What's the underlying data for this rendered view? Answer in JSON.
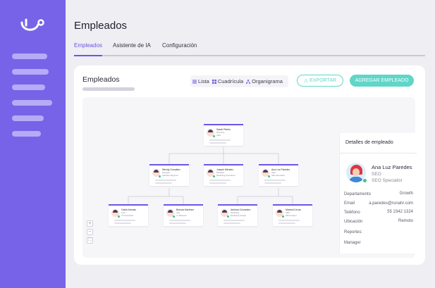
{
  "page": {
    "title": "Empleados",
    "tabs": [
      {
        "label": "Empleados",
        "active": true
      },
      {
        "label": "Asistente de IA",
        "active": false
      },
      {
        "label": "Configuración",
        "active": false
      }
    ]
  },
  "card": {
    "title": "Empleados",
    "views": {
      "list": "Lista",
      "grid": "Cuadrícula",
      "org": "Organigrama",
      "selected": "org"
    },
    "export_label": "EXPORTAR",
    "add_label": "AGREGAR EMPLEADO"
  },
  "org_chart": {
    "root": {
      "name": "Sarah Peters",
      "role": "Directora",
      "role2": "CEO"
    },
    "managers": [
      {
        "name": "Wendy González",
        "role": "Manager",
        "role2": "Software Engineer"
      },
      {
        "name": "Joseph Méndez",
        "role": "Manager",
        "role2": "Marketing Operations"
      },
      {
        "name": "Ana Luz Paredes",
        "role": "SEO",
        "role2": "SEO Specialist"
      }
    ],
    "reports": [
      {
        "name": "Caleb Arévalo",
        "role": "Tech",
        "role2": "IT Procesador"
      },
      {
        "name": "Brenda Martínez",
        "role": "Arte",
        "role2": "Jr. Backend"
      },
      {
        "name": "Adriana Cervantes",
        "role": "Marketing",
        "role2": "Marketing Analyst"
      },
      {
        "name": "Marbrel Urzúa",
        "role": "SEO",
        "role2": "SEO Analyst"
      }
    ],
    "zoom": [
      "+",
      "−",
      "⛶"
    ]
  },
  "detail": {
    "header": "Detalles de empleado",
    "name": "Ana Luz Paredes",
    "role": "SEO",
    "role2": "SEO Specialist",
    "fields": [
      {
        "label": "Departamento",
        "value": "Growth"
      },
      {
        "label": "Email",
        "value": "a.paredes@runahr.com"
      },
      {
        "label": "Teléfono",
        "value": "55 2342 1324"
      },
      {
        "label": "Ubicación",
        "value": "Remoto"
      },
      {
        "label": "Reportes:",
        "value": ""
      },
      {
        "label": "Manager",
        "value": ""
      }
    ]
  },
  "colors": {
    "sidebar": "#7763e8",
    "accent": "#6b56e4",
    "teal": "#5fd6c8"
  }
}
